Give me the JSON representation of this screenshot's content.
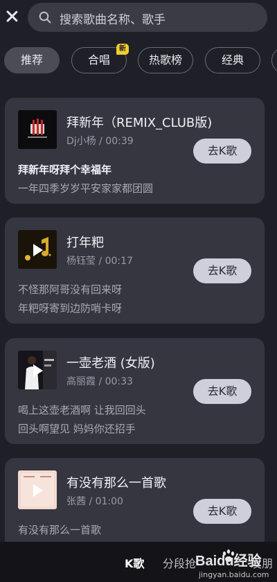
{
  "search": {
    "placeholder": "搜索歌曲名称、歌手"
  },
  "tabs": [
    {
      "label": "推荐",
      "active": true
    },
    {
      "label": "合唱",
      "badge": "新"
    },
    {
      "label": "热歌榜"
    },
    {
      "label": "经典"
    }
  ],
  "songs": [
    {
      "title": "拜新年（REMIX_CLUB版)",
      "meta": "Dj小杨 / 00:39",
      "button": "去K歌",
      "lyrics": [
        "拜新年呀拜个幸福年",
        "一年四季岁岁平安家家都团圆"
      ]
    },
    {
      "title": "打年粑",
      "meta": "杨钰莹 / 00:17",
      "button": "去K歌",
      "lyrics": [
        "不怪那阿哥没有回来呀",
        "年粑呀寄到边防哨卡呀"
      ]
    },
    {
      "title": "一壶老酒 (女版)",
      "meta": "高丽霞 / 00:33",
      "button": "去K歌",
      "lyrics": [
        "喝上这壶老酒啊 让我回回头",
        "回头啊望见 妈妈你还招手"
      ]
    },
    {
      "title": "有没有那么一首歌",
      "meta": "张茜 / 01:00",
      "button": "去K歌",
      "lyrics": [
        "有没有那么一首歌"
      ]
    }
  ],
  "bottom_nav": {
    "active": "K歌",
    "item2": "分段抢",
    "item3": "发朋"
  },
  "watermark": {
    "brand": "Baidu经验",
    "url": "jingyan.baidu.com"
  },
  "colors": {
    "background": "#1f2027",
    "card": "#353640",
    "button": "#cfcfdb",
    "badge": "#f3cc2f"
  }
}
